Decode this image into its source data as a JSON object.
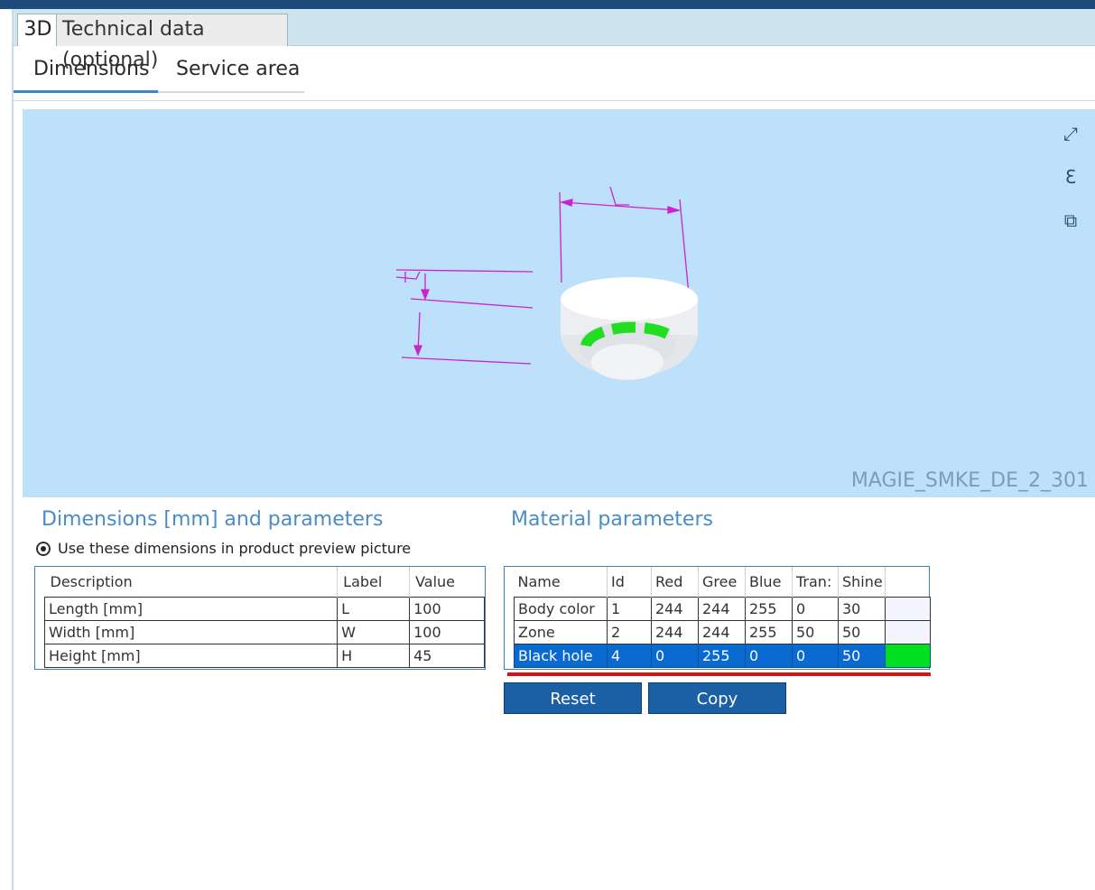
{
  "main_tabs": [
    {
      "label": "3D",
      "active": true
    },
    {
      "label": "Technical data (optional)",
      "active": false
    }
  ],
  "sub_tabs": [
    {
      "label": "Dimensions",
      "active": true
    },
    {
      "label": "Service area",
      "active": false
    }
  ],
  "viewer": {
    "model_id": "MAGIE_SMKE_DE_2_301",
    "background_color": "#bde0fb",
    "dimension_line_color": "#cc22cc",
    "dimension_labels": [
      "L",
      "H"
    ],
    "toolbar_icons": [
      "fullscreen-icon",
      "measure-icon",
      "copy-view-icon"
    ]
  },
  "dimensions": {
    "title": "Dimensions [mm] and parameters",
    "use_checkbox_label": "Use these dimensions in product preview picture",
    "use_checked": true,
    "columns": [
      "Description",
      "Label",
      "Value"
    ],
    "rows": [
      {
        "description": "Length [mm]",
        "label": "L",
        "value": "100"
      },
      {
        "description": "Width [mm]",
        "label": "W",
        "value": "100"
      },
      {
        "description": "Height [mm]",
        "label": "H",
        "value": "45"
      }
    ]
  },
  "material": {
    "title": "Material parameters",
    "columns": [
      "Name",
      "Id",
      "Red",
      "Gree",
      "Blue",
      "Tran:",
      "Shine",
      ""
    ],
    "rows": [
      {
        "name": "Body color",
        "id": "1",
        "red": "244",
        "green": "244",
        "blue": "255",
        "trans": "0",
        "shine": "30",
        "swatch": "#f4f4ff",
        "selected": false
      },
      {
        "name": "Zone",
        "id": "2",
        "red": "244",
        "green": "244",
        "blue": "255",
        "trans": "50",
        "shine": "50",
        "swatch": "#f4f4ff",
        "selected": false
      },
      {
        "name": "Black hole",
        "id": "4",
        "red": "0",
        "green": "255",
        "blue": "0",
        "trans": "0",
        "shine": "50",
        "swatch": "#00e020",
        "selected": true
      }
    ]
  },
  "buttons": {
    "reset": "Reset",
    "copy": "Copy"
  },
  "colors": {
    "accent": "#1b5fa4",
    "header_bar": "#1d4a7a",
    "selection": "#0a6ad1",
    "highlight_line": "#e01010"
  }
}
